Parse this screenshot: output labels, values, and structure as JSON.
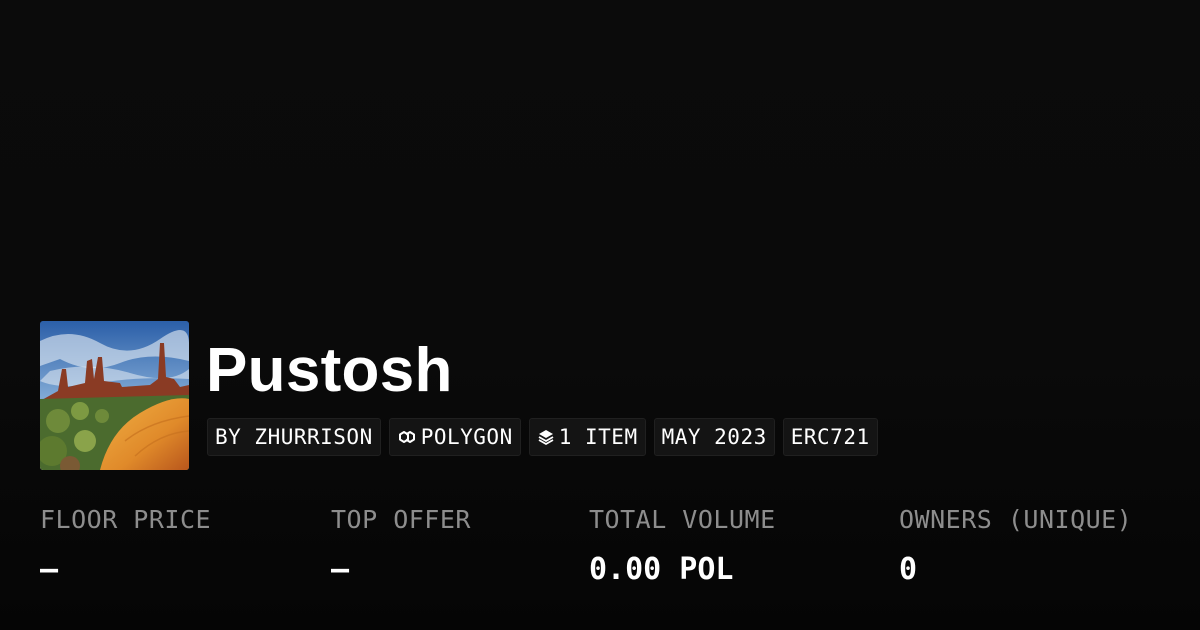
{
  "collection": {
    "name": "Pustosh",
    "image_icon": "desert-landscape-image"
  },
  "badges": {
    "creator": "BY ZHURRISON",
    "chain": "POLYGON",
    "chain_icon": "polygon-icon",
    "items": "1 ITEM",
    "items_icon": "layers-icon",
    "date": "MAY 2023",
    "standard": "ERC721"
  },
  "stats": [
    {
      "label": "FLOOR PRICE",
      "value": "–"
    },
    {
      "label": "TOP OFFER",
      "value": "–"
    },
    {
      "label": "TOTAL VOLUME",
      "value": "0.00 POL"
    },
    {
      "label": "OWNERS (UNIQUE)",
      "value": "0"
    }
  ],
  "colors": {
    "background": "#0a0a0a",
    "badge_bg": "#141414",
    "label_gray": "#8d8d8d",
    "text": "#ffffff"
  }
}
